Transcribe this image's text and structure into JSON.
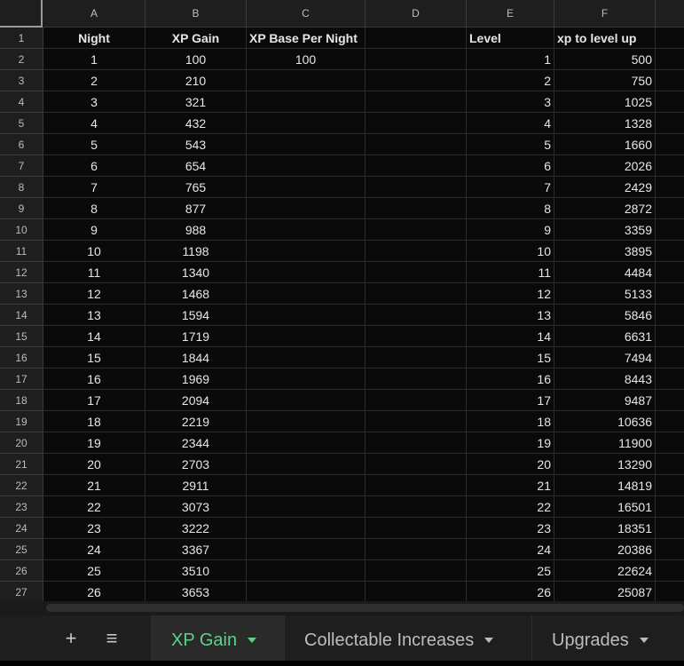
{
  "columns": [
    "A",
    "B",
    "C",
    "D",
    "E",
    "F"
  ],
  "header_row": {
    "num": "1",
    "A": "Night",
    "B": "XP Gain",
    "C": "XP Base Per Night",
    "D": "",
    "E": "Level",
    "F": "xp to level up"
  },
  "rows": [
    {
      "num": "2",
      "A": "1",
      "B": "100",
      "C": "100",
      "E": "1",
      "F": "500"
    },
    {
      "num": "3",
      "A": "2",
      "B": "210",
      "C": "",
      "E": "2",
      "F": "750"
    },
    {
      "num": "4",
      "A": "3",
      "B": "321",
      "C": "",
      "E": "3",
      "F": "1025"
    },
    {
      "num": "5",
      "A": "4",
      "B": "432",
      "C": "",
      "E": "4",
      "F": "1328"
    },
    {
      "num": "6",
      "A": "5",
      "B": "543",
      "C": "",
      "E": "5",
      "F": "1660"
    },
    {
      "num": "7",
      "A": "6",
      "B": "654",
      "C": "",
      "E": "6",
      "F": "2026"
    },
    {
      "num": "8",
      "A": "7",
      "B": "765",
      "C": "",
      "E": "7",
      "F": "2429"
    },
    {
      "num": "9",
      "A": "8",
      "B": "877",
      "C": "",
      "E": "8",
      "F": "2872"
    },
    {
      "num": "10",
      "A": "9",
      "B": "988",
      "C": "",
      "E": "9",
      "F": "3359"
    },
    {
      "num": "11",
      "A": "10",
      "B": "1198",
      "C": "",
      "E": "10",
      "F": "3895"
    },
    {
      "num": "12",
      "A": "11",
      "B": "1340",
      "C": "",
      "E": "11",
      "F": "4484"
    },
    {
      "num": "13",
      "A": "12",
      "B": "1468",
      "C": "",
      "E": "12",
      "F": "5133"
    },
    {
      "num": "14",
      "A": "13",
      "B": "1594",
      "C": "",
      "E": "13",
      "F": "5846"
    },
    {
      "num": "15",
      "A": "14",
      "B": "1719",
      "C": "",
      "E": "14",
      "F": "6631"
    },
    {
      "num": "16",
      "A": "15",
      "B": "1844",
      "C": "",
      "E": "15",
      "F": "7494"
    },
    {
      "num": "17",
      "A": "16",
      "B": "1969",
      "C": "",
      "E": "16",
      "F": "8443"
    },
    {
      "num": "18",
      "A": "17",
      "B": "2094",
      "C": "",
      "E": "17",
      "F": "9487"
    },
    {
      "num": "19",
      "A": "18",
      "B": "2219",
      "C": "",
      "E": "18",
      "F": "10636"
    },
    {
      "num": "20",
      "A": "19",
      "B": "2344",
      "C": "",
      "E": "19",
      "F": "11900"
    },
    {
      "num": "21",
      "A": "20",
      "B": "2703",
      "C": "",
      "E": "20",
      "F": "13290"
    },
    {
      "num": "22",
      "A": "21",
      "B": "2911",
      "C": "",
      "E": "21",
      "F": "14819"
    },
    {
      "num": "23",
      "A": "22",
      "B": "3073",
      "C": "",
      "E": "22",
      "F": "16501"
    },
    {
      "num": "24",
      "A": "23",
      "B": "3222",
      "C": "",
      "E": "23",
      "F": "18351"
    },
    {
      "num": "25",
      "A": "24",
      "B": "3367",
      "C": "",
      "E": "24",
      "F": "20386"
    },
    {
      "num": "26",
      "A": "25",
      "B": "3510",
      "C": "",
      "E": "25",
      "F": "22624"
    },
    {
      "num": "27",
      "A": "26",
      "B": "3653",
      "C": "",
      "E": "26",
      "F": "25087"
    }
  ],
  "tabbar": {
    "add_icon": "plus-icon",
    "all_sheets_icon": "menu-lines-icon",
    "tabs": [
      {
        "label": "XP Gain",
        "active": true
      },
      {
        "label": "Collectable Increases",
        "active": false
      },
      {
        "label": "Upgrades",
        "active": false
      }
    ],
    "active_color": "#5fd18a"
  }
}
